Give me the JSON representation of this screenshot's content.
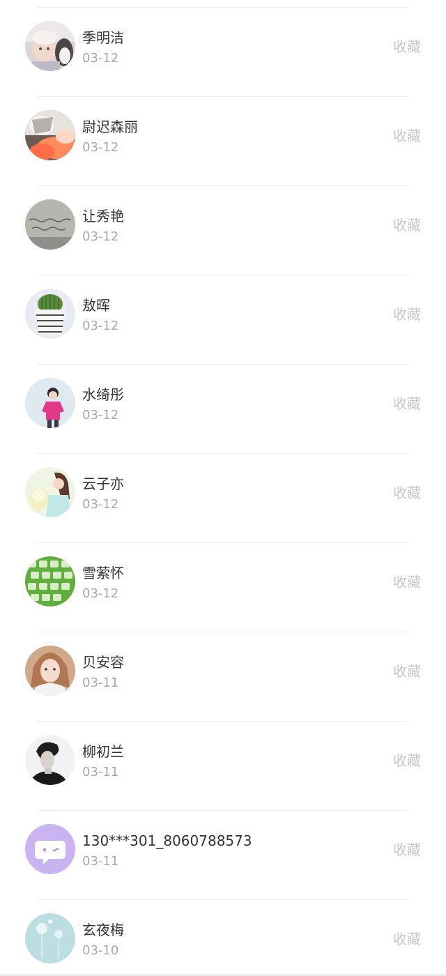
{
  "contacts": [
    {
      "name": "季明洁",
      "date": "03-12",
      "action": "收藏",
      "avatar": "baby-with-husky-photo"
    },
    {
      "name": "尉迟森丽",
      "date": "03-12",
      "action": "收藏",
      "avatar": "butterfly-on-orange-flowers-photo"
    },
    {
      "name": "让秀艳",
      "date": "03-12",
      "action": "收藏",
      "avatar": "handwritten-note-photo"
    },
    {
      "name": "敖晖",
      "date": "03-12",
      "action": "收藏",
      "avatar": "potted-cactus-photo"
    },
    {
      "name": "水绮彤",
      "date": "03-12",
      "action": "收藏",
      "avatar": "person-in-pink-sweater-photo"
    },
    {
      "name": "云子亦",
      "date": "03-12",
      "action": "收藏",
      "avatar": "girl-with-plush-toy-photo"
    },
    {
      "name": "雪萦怀",
      "date": "03-12",
      "action": "收藏",
      "avatar": "green-keyboard-keys-photo"
    },
    {
      "name": "贝安容",
      "date": "03-11",
      "action": "收藏",
      "avatar": "young-woman-portrait-photo"
    },
    {
      "name": "柳初兰",
      "date": "03-11",
      "action": "收藏",
      "avatar": "man-black-and-white-portrait-photo"
    },
    {
      "name": "130***301_8060788573",
      "date": "03-11",
      "action": "收藏",
      "avatar": "default-chat-bubble-avatar"
    },
    {
      "name": "玄夜梅",
      "date": "03-10",
      "action": "收藏",
      "avatar": "dandelion-light-blue-photo"
    }
  ],
  "colors": {
    "name_text": "#333333",
    "date_text": "#a8a8a8",
    "action_text": "#c8c8c8",
    "divider": "#eeeeee",
    "default_avatar_bg": "#c9b3f0"
  }
}
